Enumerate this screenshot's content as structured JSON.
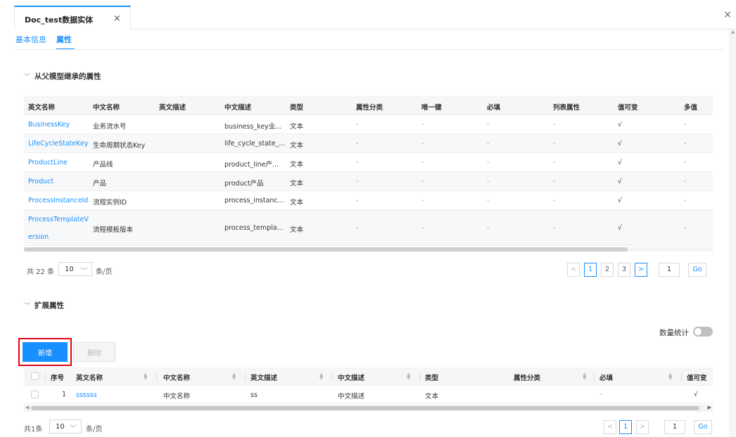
{
  "doc_tab": {
    "title": "Doc_test数据实体",
    "close": "×"
  },
  "window_close": "×",
  "subtabs": [
    {
      "label": "基本信息"
    },
    {
      "label": "属性"
    }
  ],
  "inherited": {
    "title": "从父模型继承的属性",
    "columns": [
      "英文名称",
      "中文名称",
      "英文描述",
      "中文描述",
      "类型",
      "属性分类",
      "唯一键",
      "必填",
      "列表属性",
      "值可变",
      "多值"
    ],
    "rows": [
      [
        "BusinessKey",
        "业务流水号",
        "",
        "business_key业...",
        "文本",
        "-",
        "-",
        "-",
        "-",
        "√",
        "-"
      ],
      [
        "LifeCycleStateKey",
        "生命周期状态Key",
        "",
        "life_cycle_state_...",
        "文本",
        "-",
        "-",
        "-",
        "-",
        "√",
        "-"
      ],
      [
        "ProductLine",
        "产品线",
        "",
        "product_line产...",
        "文本",
        "-",
        "-",
        "-",
        "-",
        "√",
        "-"
      ],
      [
        "Product",
        "产品",
        "",
        "product产品",
        "文本",
        "-",
        "-",
        "-",
        "-",
        "√",
        "-"
      ],
      [
        "ProcessInstanceId",
        "流程实例ID",
        "",
        "process_instanc...",
        "文本",
        "-",
        "-",
        "-",
        "-",
        "√",
        "-"
      ],
      [
        "ProcessTemplateVersion",
        "流程模板版本",
        "",
        "process_templa...",
        "文本",
        "-",
        "-",
        "-",
        "-",
        "√",
        "-"
      ]
    ],
    "row6_name_line1": "ProcessTemplateV",
    "row6_name_line2": "ersion",
    "pager": {
      "total": "共 22 条",
      "pagesize": "10",
      "unit": "条/页",
      "pages": [
        "1",
        "2",
        "3"
      ],
      "current": "1",
      "go_value": "1",
      "go_label": "Go",
      "prev": "<",
      "next": ">"
    }
  },
  "extended": {
    "title": "扩展属性",
    "toggle_label": "数量统计",
    "add_label": "新增",
    "delete_label": "删除",
    "columns": [
      "序号",
      "英文名称",
      "中文名称",
      "英文描述",
      "中文描述",
      "类型",
      "属性分类",
      "必填",
      "值可变"
    ],
    "rows": [
      [
        "1",
        "ssssss",
        "中文名称",
        "ss",
        "中文描述",
        "文本",
        "",
        "-",
        "√"
      ]
    ],
    "pager": {
      "total": "共1条",
      "pagesize": "10",
      "unit": "条/页",
      "pages": [
        "1"
      ],
      "current": "1",
      "go_value": "1",
      "go_label": "Go",
      "prev": "<",
      "next": ">"
    }
  },
  "icons": {
    "chevron_down": "chevron-down-icon",
    "sort": "sort-icon",
    "close": "close-icon"
  },
  "colors": {
    "accent": "#1890ff",
    "highlight_border": "#e60012"
  }
}
